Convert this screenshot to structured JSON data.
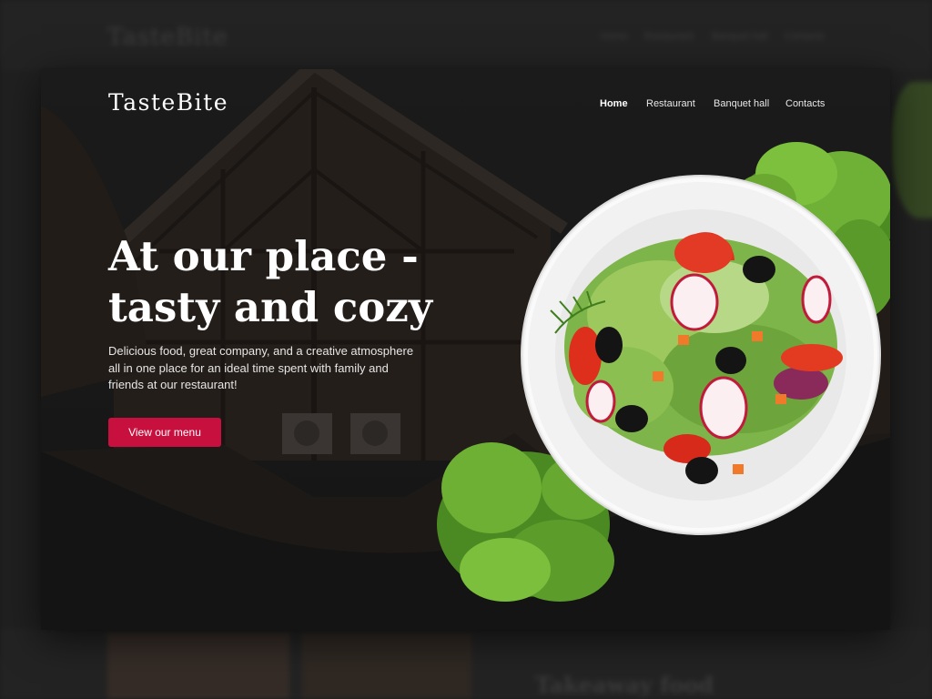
{
  "background_page": {
    "logo": "TasteBite",
    "nav": [
      "Home",
      "Restaurant",
      "Banquet hall",
      "Contacts"
    ],
    "section_heading": "Takeaway food"
  },
  "header": {
    "logo": "TasteBite",
    "nav": {
      "home": "Home",
      "restaurant": "Restaurant",
      "banquet_hall": "Banquet hall",
      "contacts": "Contacts"
    },
    "active_item": "Home"
  },
  "hero": {
    "title_line1": "At our place -",
    "title_line2": "tasty and cozy",
    "description": "Delicious food, great company, and a creative atmosphere all in one place for an ideal time spent with family and friends at our restaurant!",
    "cta_label": "View our menu"
  },
  "colors": {
    "accent": "#c8103e",
    "card_background": "#171717",
    "text": "#ffffff"
  },
  "icons": [
    "salad-plate-image",
    "lettuce-image",
    "house-background-image"
  ]
}
